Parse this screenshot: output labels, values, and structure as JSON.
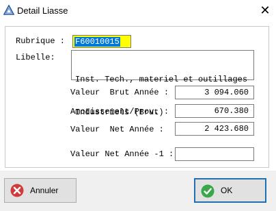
{
  "window": {
    "title": "Detail Liasse",
    "close_glyph": "✕",
    "icon": "app-triangle-icon"
  },
  "form": {
    "rubrique_label": "Rubrique :",
    "rubrique_value": "F60010015",
    "libelle_label": "Libelle:",
    "libelle_line1": "Inst. Tech., materiel et outillages",
    "libelle_line2": "Industriels (Brut)",
    "brut_label": "Valeur  Brut Année :",
    "brut_value": "3 094.060",
    "amort_label": "Amotissement/Prov. :",
    "amort_value": "670.380",
    "net_label": "Valeur  Net Année :",
    "net_value": "2 423.680",
    "net_prev_label": "Valeur Net Année -1 :",
    "net_prev_value": ""
  },
  "buttons": {
    "annuler_label": "Annuler",
    "ok_label": "OK",
    "annuler_icon": "cancel-x-icon",
    "ok_icon": "check-icon"
  },
  "colors": {
    "rubrique_bg": "#ffff00",
    "selection": "#0078d7",
    "ok_border": "#1f6fb2",
    "cancel_icon": "#d23b3b",
    "ok_icon": "#3aa84a"
  }
}
